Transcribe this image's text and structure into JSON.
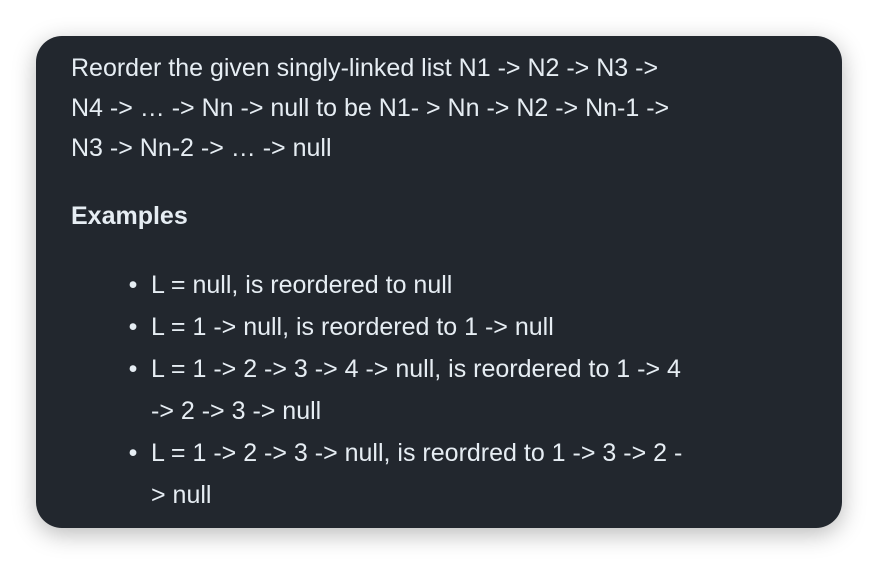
{
  "intro_lines": [
    "Reorder the given singly-linked list N1 -> N2 -> N3 ->",
    "N4 -> … -> Nn -> null to be N1- > Nn -> N2 -> Nn-1 ->",
    "N3 -> Nn-2 -> … -> null"
  ],
  "examples_heading": "Examples",
  "examples": [
    {
      "lines": [
        "L = null, is reordered to null"
      ]
    },
    {
      "lines": [
        "L = 1 -> null, is reordered to 1 -> null"
      ]
    },
    {
      "lines": [
        "L = 1 -> 2 -> 3 -> 4 -> null, is reordered to 1 -> 4",
        "-> 2 -> 3 -> null"
      ]
    },
    {
      "lines": [
        "L = 1 -> 2 -> 3 -> null, is reordred to 1 -> 3 -> 2 -",
        "> null"
      ]
    }
  ],
  "bullet_glyph": "•"
}
